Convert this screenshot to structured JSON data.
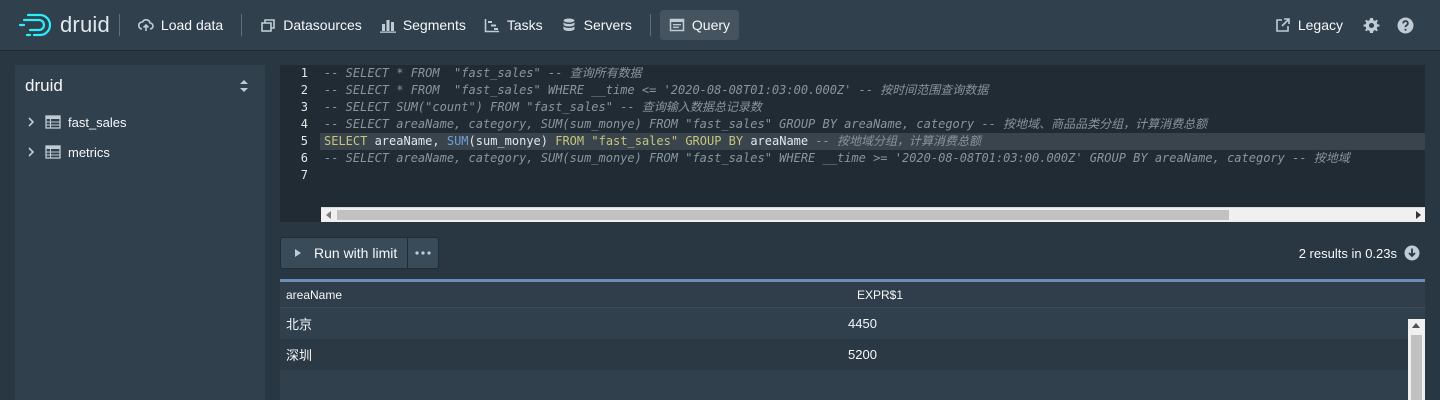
{
  "app": {
    "logo_text": "druid"
  },
  "nav": {
    "items": [
      {
        "label": "Load data",
        "icon": "cloud-upload-icon"
      },
      {
        "label": "Datasources",
        "icon": "multi-select-icon"
      },
      {
        "label": "Segments",
        "icon": "stacked-chart-icon"
      },
      {
        "label": "Tasks",
        "icon": "gantt-chart-icon"
      },
      {
        "label": "Servers",
        "icon": "database-icon"
      },
      {
        "label": "Query",
        "icon": "application-icon",
        "active": true
      }
    ],
    "right": {
      "legacy_label": "Legacy",
      "settings_icon": "cog-icon",
      "help_icon": "help-icon"
    }
  },
  "sidebar": {
    "title": "druid",
    "items": [
      {
        "label": "fast_sales",
        "icon": "th-icon"
      },
      {
        "label": "metrics",
        "icon": "th-icon"
      }
    ]
  },
  "editor": {
    "line_numbers": [
      "1",
      "2",
      "3",
      "4",
      "5",
      "6",
      "7"
    ],
    "lines": [
      "-- SELECT * FROM  \"fast_sales\" -- 查询所有数据",
      "-- SELECT * FROM  \"fast_sales\" WHERE __time <= '2020-08-08T01:03:00.000Z' -- 按时间范围查询数据",
      "-- SELECT SUM(\"count\") FROM \"fast_sales\" -- 查询输入数据总记录数",
      "-- SELECT areaName, category, SUM(sum_monye) FROM \"fast_sales\" GROUP BY areaName, category -- 按地域、商品品类分组，计算消费总额",
      {
        "kw1": "SELECT",
        "t1": " areaName, ",
        "fn": "SUM",
        "t2": "(sum_monye) ",
        "kw2": "FROM",
        "t3": " ",
        "str": "\"fast_sales\"",
        "t4": " ",
        "kw3": "GROUP BY",
        "t5": " areaName ",
        "cmt": "-- 按地域分组，计算消费总额"
      },
      "-- SELECT areaName, category, SUM(sum_monye) FROM \"fast_sales\" WHERE __time >= '2020-08-08T01:03:00.000Z' GROUP BY areaName, category -- 按地域",
      ""
    ]
  },
  "run": {
    "label": "Run with limit",
    "more_icon": "more-icon"
  },
  "results": {
    "summary": "2 results in 0.23s",
    "columns": [
      "areaName",
      "EXPR$1"
    ],
    "rows": [
      [
        "北京",
        "4450"
      ],
      [
        "深圳",
        "5200"
      ]
    ]
  },
  "colors": {
    "navbar": "#30404d",
    "background": "#293742",
    "editor": "#202b33",
    "accent": "#6b8eb5"
  }
}
